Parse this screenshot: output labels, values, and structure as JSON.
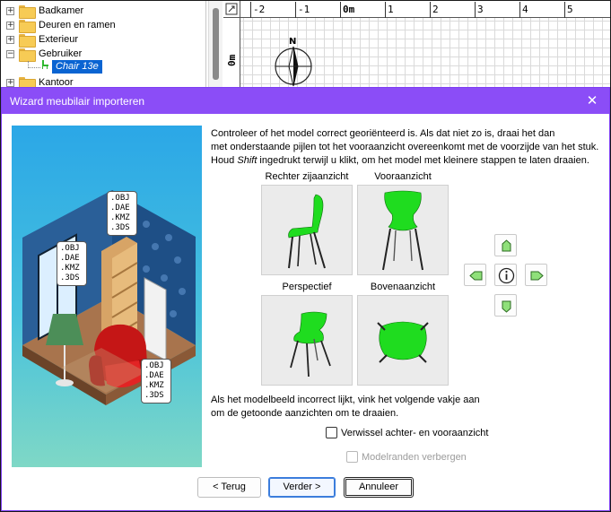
{
  "tree": {
    "items": [
      {
        "label": "Badkamer",
        "expander": "+"
      },
      {
        "label": "Deuren en ramen",
        "expander": "+"
      },
      {
        "label": "Exterieur",
        "expander": "+"
      },
      {
        "label": "Gebruiker",
        "expander": "−"
      },
      {
        "label": "Kantoor",
        "expander": "+"
      }
    ],
    "selected_child": "Chair 13e"
  },
  "plan": {
    "ruler_labels": [
      "-2",
      "-1",
      "0m",
      "1",
      "2",
      "3",
      "4",
      "5"
    ],
    "left_ruler_label": "0m",
    "compass_letter": "N"
  },
  "dialog": {
    "title": "Wizard meubilair importeren",
    "close_icon": "close-icon",
    "instructions": {
      "line1": "Controleer of het model correct georiënteerd is. Als dat niet zo is, draai het dan",
      "line2": "met onderstaande pijlen tot het vooraanzicht overeenkomt met de voorzijde van het stuk.",
      "line3_before": "Houd ",
      "line3_italic": "Shift",
      "line3_after": " ingedrukt terwijl u klikt, om het model met kleinere stappen te laten draaien."
    },
    "views": {
      "right_side": "Rechter zijaanzicht",
      "front": "Vooraanzicht",
      "perspective": "Perspectief",
      "top": "Bovenaanzicht"
    },
    "illustration_tags": [
      ".OBJ\n.DAE\n.KMZ\n.3DS",
      ".OBJ\n.DAE\n.KMZ\n.3DS",
      ".OBJ\n.DAE\n.KMZ\n.3DS"
    ],
    "incorrect_text": {
      "line1": "Als het modelbeeld incorrect lijkt, vink het volgende vakje aan",
      "line2": "om de getoonde aanzichten om te draaien."
    },
    "swap_checkbox": {
      "label": "Verwissel achter- en vooraanzicht",
      "checked": false
    },
    "hide_edges_checkbox": {
      "label": "Modelranden verbergen",
      "checked": false,
      "enabled": false
    },
    "buttons": {
      "back": "< Terug",
      "next": "Verder >",
      "cancel": "Annuleer"
    }
  },
  "colors": {
    "titlebar": "#8b4df7",
    "model_green": "#2ee82e",
    "selection": "#0a64d2"
  }
}
